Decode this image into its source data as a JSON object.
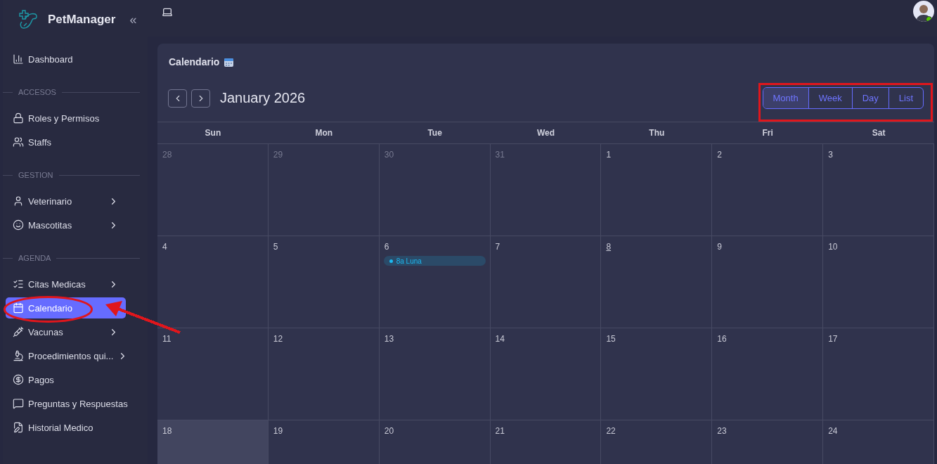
{
  "app": {
    "name": "PetManager",
    "collapse": "«"
  },
  "sidebar": {
    "items": [
      {
        "label": "Dashboard",
        "selected": false,
        "has_children": false
      },
      {
        "section": "ACCESOS"
      },
      {
        "label": "Roles y Permisos",
        "selected": false,
        "has_children": false
      },
      {
        "label": "Staffs",
        "selected": false,
        "has_children": false
      },
      {
        "section": "GESTION"
      },
      {
        "label": "Veterinario",
        "selected": false,
        "has_children": true
      },
      {
        "label": "Mascotitas",
        "selected": false,
        "has_children": true
      },
      {
        "section": "AGENDA"
      },
      {
        "label": "Citas Medicas",
        "selected": false,
        "has_children": true
      },
      {
        "label": "Calendario",
        "selected": true,
        "has_children": false
      },
      {
        "label": "Vacunas",
        "selected": false,
        "has_children": true
      },
      {
        "label": "Procedimientos qui...",
        "selected": false,
        "has_children": true
      },
      {
        "label": "Pagos",
        "selected": false,
        "has_children": false
      },
      {
        "label": "Preguntas y Respuestas",
        "selected": false,
        "has_children": false
      },
      {
        "label": "Historial Medico",
        "selected": false,
        "has_children": false
      }
    ]
  },
  "user": {
    "online": true
  },
  "page": {
    "title": "Calendario"
  },
  "calendar": {
    "month": "January 2026",
    "views": [
      {
        "label": "Month",
        "selected": true
      },
      {
        "label": "Week",
        "selected": false
      },
      {
        "label": "Day",
        "selected": false
      },
      {
        "label": "List",
        "selected": false
      }
    ],
    "weekdays": [
      "Sun",
      "Mon",
      "Tue",
      "Wed",
      "Thu",
      "Fri",
      "Sat"
    ],
    "weeks": [
      [
        {
          "day": "28",
          "other_month": true
        },
        {
          "day": "29",
          "other_month": true
        },
        {
          "day": "30",
          "other_month": true
        },
        {
          "day": "31",
          "other_month": true
        },
        {
          "day": "1",
          "other_month": false
        },
        {
          "day": "2",
          "other_month": false
        },
        {
          "day": "3",
          "other_month": false
        }
      ],
      [
        {
          "day": "4",
          "other_month": false
        },
        {
          "day": "5",
          "other_month": false
        },
        {
          "day": "6",
          "other_month": false,
          "events": [
            {
              "label": "8a Luna",
              "color": "#1cb8f0"
            }
          ]
        },
        {
          "day": "7",
          "other_month": false
        },
        {
          "day": "8",
          "other_month": false,
          "underlined": true
        },
        {
          "day": "9",
          "other_month": false
        },
        {
          "day": "10",
          "other_month": false
        }
      ],
      [
        {
          "day": "11",
          "other_month": false
        },
        {
          "day": "12",
          "other_month": false
        },
        {
          "day": "13",
          "other_month": false
        },
        {
          "day": "14",
          "other_month": false
        },
        {
          "day": "15",
          "other_month": false
        },
        {
          "day": "16",
          "other_month": false
        },
        {
          "day": "17",
          "other_month": false
        }
      ],
      [
        {
          "day": "18",
          "other_month": false,
          "highlighted": true
        },
        {
          "day": "19",
          "other_month": false
        },
        {
          "day": "20",
          "other_month": false
        },
        {
          "day": "21",
          "other_month": false
        },
        {
          "day": "22",
          "other_month": false
        },
        {
          "day": "23",
          "other_month": false
        },
        {
          "day": "24",
          "other_month": false
        }
      ]
    ]
  },
  "annotations": [
    {
      "kind": "ellipse",
      "color": "#e0161c"
    },
    {
      "kind": "arrow",
      "color": "#e0161c"
    },
    {
      "kind": "rectangle",
      "color": "#e0161c"
    }
  ]
}
